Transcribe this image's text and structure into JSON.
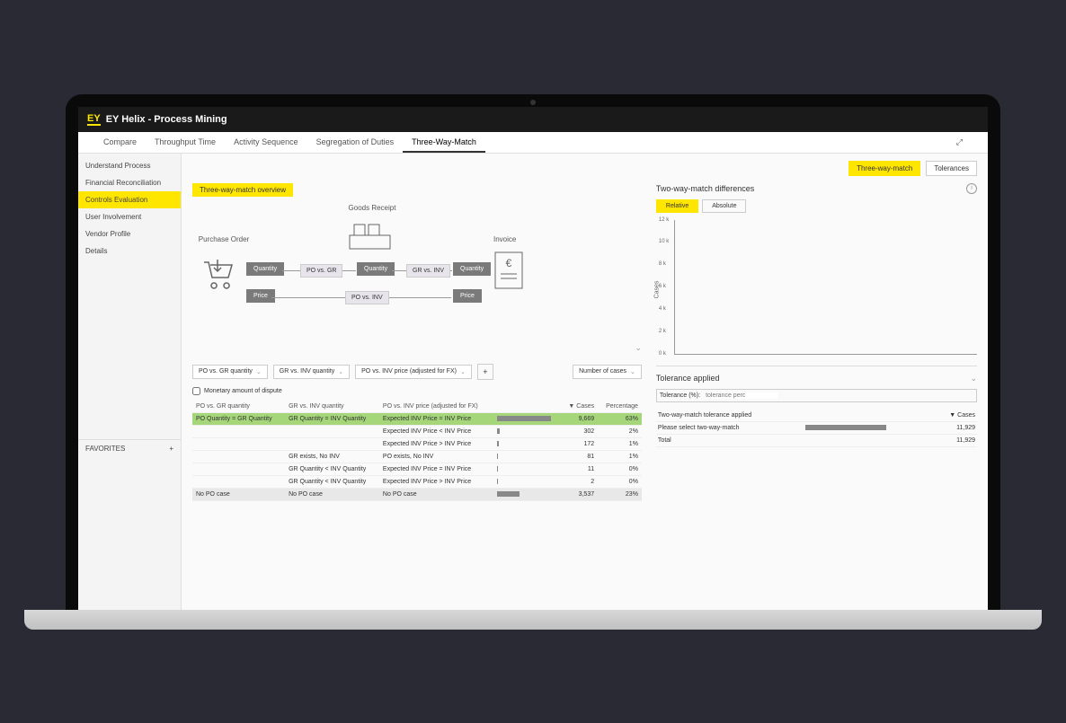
{
  "header": {
    "logo": "EY",
    "title": "EY Helix - Process Mining"
  },
  "tabs": [
    "Compare",
    "Throughput Time",
    "Activity Sequence",
    "Segregation of Duties",
    "Three-Way-Match"
  ],
  "activeTab": 4,
  "sidebar": [
    "Understand Process",
    "Financial Reconciliation",
    "Controls Evaluation",
    "User Involvement",
    "Vendor Profile",
    "Details"
  ],
  "activeSide": 2,
  "favorites": "FAVORITES",
  "topButtons": {
    "a": "Three-way-match",
    "b": "Tolerances"
  },
  "overviewTag": "Three-way-match overview",
  "diagram": {
    "po": "Purchase Order",
    "gr": "Goods Receipt",
    "inv": "Invoice",
    "qty": "Quantity",
    "price": "Price",
    "poGr": "PO vs. GR",
    "grInv": "GR vs. INV",
    "poInv": "PO vs. INV"
  },
  "filters": [
    "PO vs. GR quantity",
    "GR vs. INV quantity",
    "PO vs. INV price (adjusted for FX)",
    "Number of cases"
  ],
  "checkbox": "Monetary amount of dispute",
  "table": {
    "headers": [
      "PO vs. GR quantity",
      "GR vs. INV quantity",
      "PO vs. INV price (adjusted for FX)",
      "",
      "▼ Cases",
      "Percentage"
    ],
    "rows": [
      {
        "c": [
          "PO Quantity = GR Quantity",
          "GR Quantity = INV Quantity",
          "Expected INV Price = INV Price"
        ],
        "cases": "9,669",
        "pct": "63%",
        "green": true,
        "bar": 60
      },
      {
        "c": [
          "",
          "",
          "Expected INV Price < INV Price"
        ],
        "cases": "302",
        "pct": "2%",
        "bar": 3
      },
      {
        "c": [
          "",
          "",
          "Expected INV Price > INV Price"
        ],
        "cases": "172",
        "pct": "1%",
        "bar": 2
      },
      {
        "c": [
          "",
          "GR exists, No INV",
          "PO exists, No INV"
        ],
        "cases": "81",
        "pct": "1%",
        "bar": 1
      },
      {
        "c": [
          "",
          "GR Quantity < INV Quantity",
          "Expected INV Price = INV Price"
        ],
        "cases": "11",
        "pct": "0%",
        "bar": 1
      },
      {
        "c": [
          "",
          "GR Quantity < INV Quantity",
          "Expected INV Price > INV Price"
        ],
        "cases": "2",
        "pct": "0%",
        "bar": 1
      },
      {
        "c": [
          "No PO case",
          "No PO case",
          "No PO case"
        ],
        "cases": "3,537",
        "pct": "23%",
        "grey": true,
        "bar": 25
      }
    ]
  },
  "right": {
    "diffTitle": "Two-way-match differences",
    "rel": "Relative",
    "abs": "Absolute",
    "yAxis": "Cases",
    "yTicks": [
      "12 k",
      "10 k",
      "8 k",
      "6 k",
      "4 k",
      "2 k",
      "0 k"
    ],
    "tolTitle": "Tolerance applied",
    "tolLabel": "Tolerance (%):",
    "tolPlaceholder": "tolerance perc",
    "tolTable": {
      "h": [
        "Two-way-match tolerance applied",
        "",
        "▼ Cases"
      ],
      "r1": [
        "Please select two-way-match",
        "11,929"
      ],
      "r2": [
        "Total",
        "11,929"
      ]
    }
  },
  "chart_data": {
    "type": "bar",
    "title": "Two-way-match differences",
    "ylabel": "Cases",
    "ylim": [
      0,
      12000
    ],
    "yticks": [
      0,
      2000,
      4000,
      6000,
      8000,
      10000,
      12000
    ],
    "categories": [],
    "values": []
  }
}
